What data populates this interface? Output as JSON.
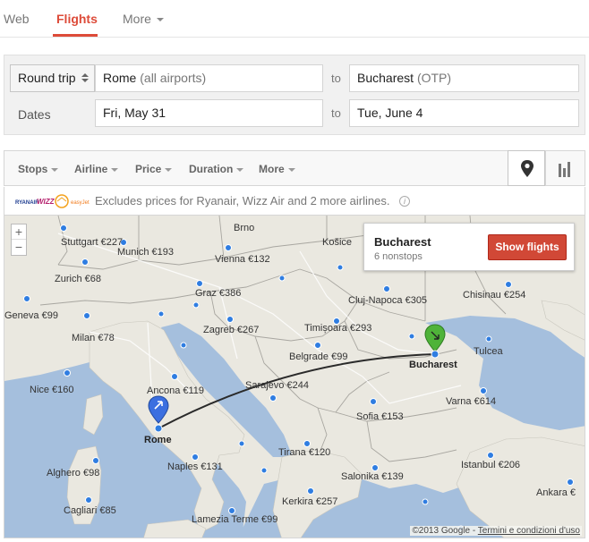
{
  "nav": {
    "tabs": [
      "Web",
      "Flights",
      "More"
    ]
  },
  "search": {
    "trip_type": "Round trip",
    "origin_city": "Rome",
    "origin_detail": "(all airports)",
    "destination_city": "Bucharest",
    "destination_code": "(OTP)",
    "to_label": "to",
    "dates_label": "Dates",
    "depart_date": "Fri, May 31",
    "return_date": "Tue, June 4"
  },
  "filters": [
    "Stops",
    "Airline",
    "Price",
    "Duration",
    "More"
  ],
  "view_icons": {
    "map": "map-pin-icon",
    "chart": "bar-chart-icon"
  },
  "notice": {
    "logos": [
      "ryanair",
      "wizz",
      "lufthansa",
      "easyjet"
    ],
    "text": "Excludes prices for Ryanair, Wizz Air and 2 more airlines.",
    "info_icon": "i"
  },
  "map": {
    "zoom_in": "+",
    "zoom_out": "−",
    "popup": {
      "city": "Bucharest",
      "subtitle": "6 nonstops",
      "button": "Show flights"
    },
    "origin_label": "Rome",
    "destination_label": "Bucharest",
    "place_names": [
      "Brno",
      "Košice"
    ],
    "price_labels": [
      "Stuttgart €227",
      "Munich €193",
      "Zurich €68",
      "Vienna €132",
      "Graz €386",
      "Geneva €99",
      "Milan €78",
      "Zagreb €267",
      "Cluj-Napoca €305",
      "Chisinau €254",
      "Timișoara €293",
      "Belgrade €99",
      "Nice €160",
      "Ancona €119",
      "Sarajevo €244",
      "Varna €614",
      "Sofia €153",
      "Tirana €120",
      "Naples €131",
      "Istanbul €206",
      "Alghero €98",
      "Salonika €139",
      "Ankara €",
      "Cagliari €85",
      "Kerkira €257",
      "Lamezia Terme €99"
    ],
    "sea_labels": [
      "Tulcea"
    ],
    "copyright": "©2013 Google -",
    "terms": "Termini e condizioni d'uso"
  },
  "colors": {
    "accent": "#dd4b39",
    "button": "#d14836",
    "origin_pin": "#3b6fe0",
    "destination_pin": "#4fb339",
    "dot": "#2f7de1"
  }
}
